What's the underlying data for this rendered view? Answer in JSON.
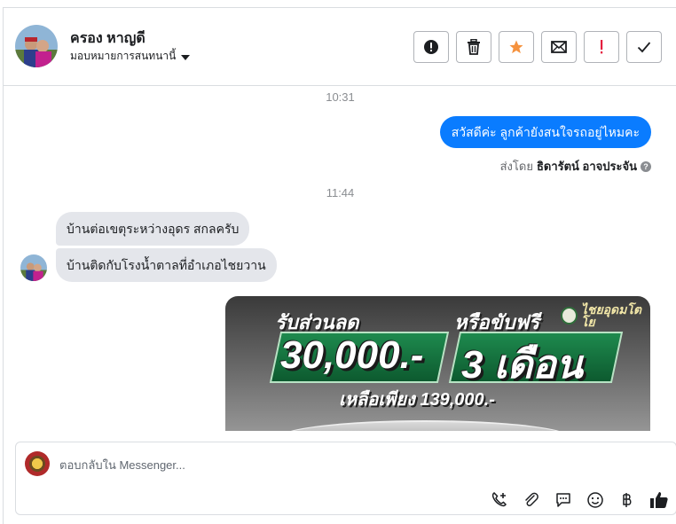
{
  "header": {
    "contact_name": "ครอง หาญดี",
    "assign_label": "มอบหมายการสนทนานี้",
    "tools": [
      {
        "name": "mark-spam",
        "icon": "alert-circle-icon"
      },
      {
        "name": "delete",
        "icon": "trash-icon"
      },
      {
        "name": "star",
        "icon": "star-icon"
      },
      {
        "name": "mark-unread",
        "icon": "envelope-icon"
      },
      {
        "name": "follow-up",
        "icon": "exclamation-icon"
      },
      {
        "name": "done",
        "icon": "checkmark-icon"
      }
    ]
  },
  "conversation": {
    "time_1": "10:31",
    "outgoing_message": "สวัสดีค่ะ ลูกค้ายังสนใจรถอยู่ไหมคะ",
    "sent_by_label": "ส่งโดย",
    "sent_by_name": "ธิดารัตน์ อาจประจัน",
    "help_icon": "?",
    "time_2": "11:44",
    "incoming_messages": [
      "บ้านต่อเขตุระหว่างอุดร สกลครับ",
      "บ้านติดกับโรงน้ำตาลที่อำเภอไชยวาน"
    ],
    "promo_image": {
      "text_left_top": "รับส่วนลด",
      "text_right_top": "หรือขับฟรี",
      "big_left": "30,000.-",
      "big_right": "3 เดือน",
      "bottom_text": "เหลือเพียง 139,000.-",
      "logo_text": "ไชยอุดมโตโย"
    }
  },
  "composer": {
    "placeholder": "ตอบกลับใน Messenger...",
    "tool_icons": [
      "add-call-icon",
      "attachment-icon",
      "saved-reply-icon",
      "emoji-icon",
      "baht-icon",
      "like-icon"
    ]
  },
  "colors": {
    "outgoing_bubble": "#0a7cff",
    "incoming_bubble": "#e4e6eb",
    "star": "#f5923e",
    "follow_up": "#e41e3f"
  }
}
